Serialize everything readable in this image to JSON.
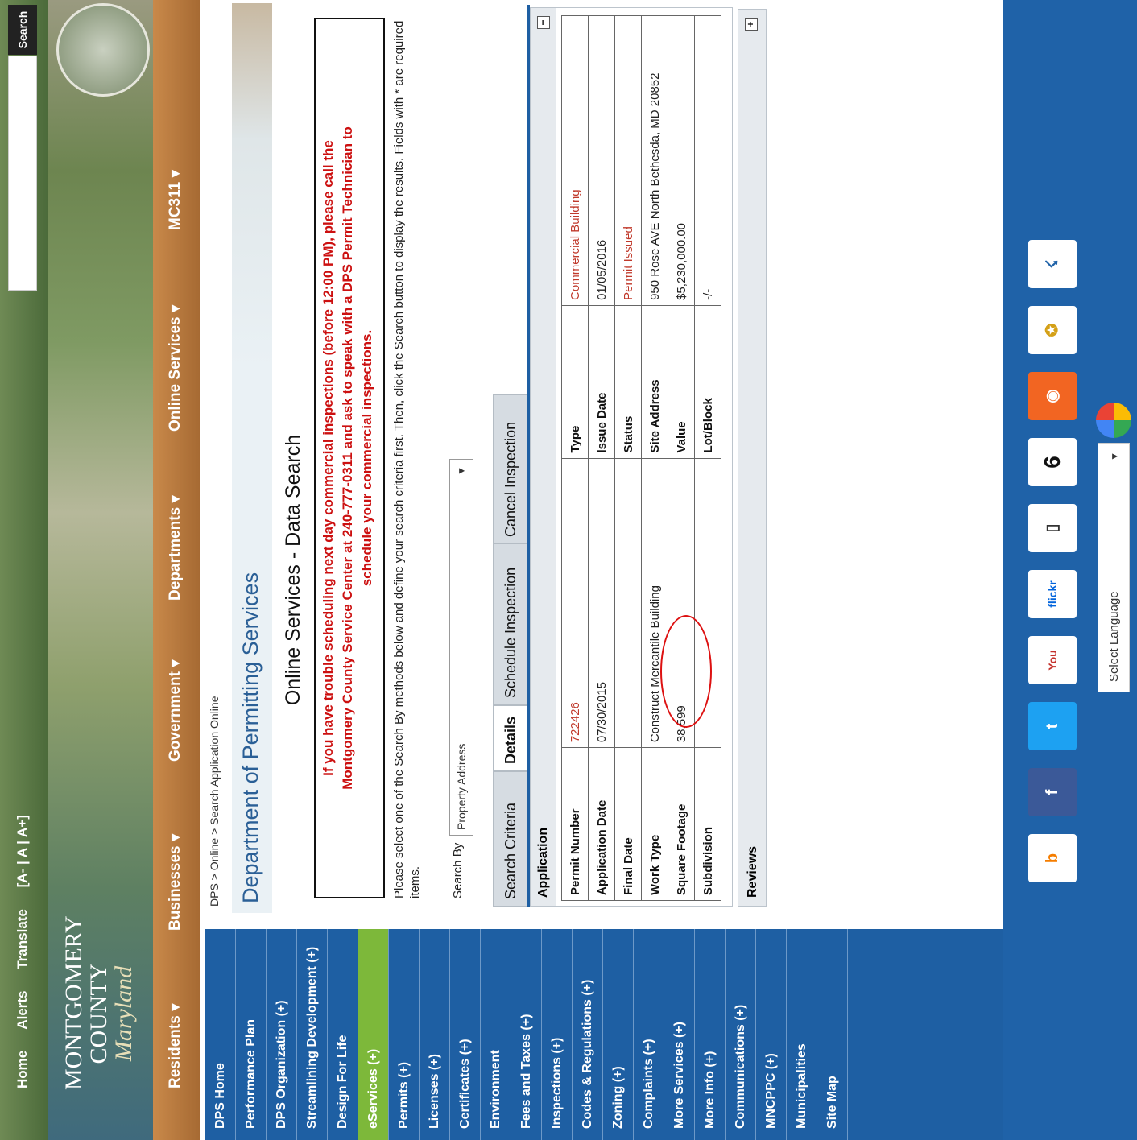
{
  "top": {
    "links": [
      "Home",
      "Alerts",
      "Translate",
      "[A- | A | A+]"
    ],
    "search_button": "Search"
  },
  "logo": {
    "line1": "MONTGOMERY",
    "line2": "COUNTY",
    "line3": "Maryland"
  },
  "nav": [
    "Residents ▾",
    "Businesses ▾",
    "Government ▾",
    "Departments ▾",
    "Online Services ▾",
    "MC311 ▾"
  ],
  "sidebar": [
    "DPS Home",
    "Performance Plan",
    "DPS Organization (+)",
    "Streamlining Development (+)",
    "Design For Life",
    "eServices (+)",
    "Permits (+)",
    "Licenses (+)",
    "Certificates (+)",
    "Environment",
    "Fees and Taxes (+)",
    "Inspections (+)",
    "Codes & Regulations (+)",
    "Zoning (+)",
    "Complaints (+)",
    "More Services (+)",
    "More Info (+)",
    "Communications (+)",
    "MNCPPC (+)",
    "Municipalities",
    "Site Map"
  ],
  "breadcrumb": "DPS > Online > Search Application Online",
  "department": "Department of Permitting Services",
  "page_title": "Online Services - Data Search",
  "alert": {
    "line1": "If you have trouble scheduling next day commercial inspections (before 12:00 PM), please call the",
    "line2": "Montgomery County Service Center at 240-777-0311 and ask to speak with a DPS Permit Technician to",
    "line3": "schedule your commercial inspections."
  },
  "instructions": "Please select one of the Search By methods below and define your search criteria first. Then, click the Search button to display the results. Fields with * are required items.",
  "search_by": {
    "label": "Search By",
    "value": "Property Address"
  },
  "tabs": [
    "Search Criteria",
    "Details",
    "Schedule Inspection",
    "Cancel Inspection"
  ],
  "active_tab": "Details",
  "application": {
    "header": "Application",
    "rows": [
      {
        "l1": "Permit Number",
        "v1": "722426",
        "l2": "Type",
        "v2": "Commercial Building"
      },
      {
        "l1": "Application Date",
        "v1": "07/30/2015",
        "l2": "Issue Date",
        "v2": "01/05/2016"
      },
      {
        "l1": "Final Date",
        "v1": "",
        "l2": "Status",
        "v2": "Permit Issued"
      },
      {
        "l1": "Work Type",
        "v1": "Construct Mercantile Building",
        "l2": "Site Address",
        "v2": "950 Rose AVE North Bethesda, MD 20852"
      },
      {
        "l1": "Square Footage",
        "v1": "38,599",
        "l2": "Value",
        "v2": "$5,230,000.00"
      },
      {
        "l1": "Subdivision",
        "v1": "",
        "l2": "Lot/Block",
        "v2": "-/-"
      }
    ]
  },
  "reviews": "Reviews",
  "footer": {
    "social_icons": [
      "blogger-icon",
      "facebook-icon",
      "twitter-icon",
      "youtube-icon",
      "flickr-icon",
      "mobile-icon",
      "calendar-icon",
      "rss-icon",
      "award-icon",
      "runner-icon"
    ],
    "calendar_day": "6",
    "language": "Select Language"
  },
  "colors": {
    "nav": "#b5763c",
    "sidebar": "#1e5fa3",
    "alert": "#cc1010",
    "active_item": "#7db83a"
  }
}
